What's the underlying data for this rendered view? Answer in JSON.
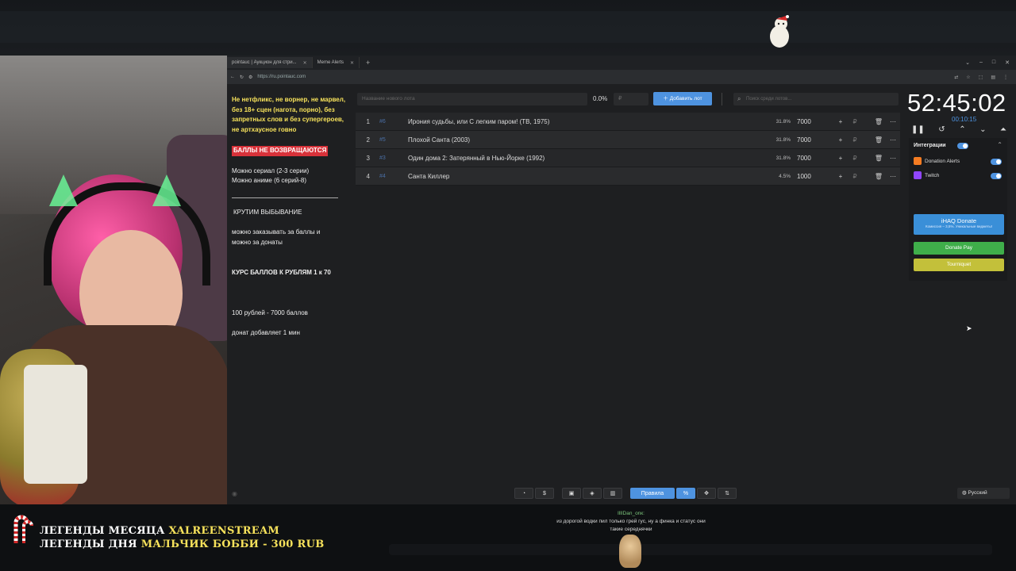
{
  "browser": {
    "tabs": [
      {
        "label": "pointauc | Аукцион для стри...",
        "active": true
      },
      {
        "label": "Meme Alerts",
        "active": false
      }
    ],
    "url": "https://ru.pointauc.com"
  },
  "rules": {
    "headline": "Не нетфликс, не ворнер, не марвел, без 18+ сцен (нагота, порно), без запретных слов и без супергероев, не артхаусное говно",
    "no_refund": "БАЛЛЫ НЕ ВОЗВРАЩАЮТСЯ",
    "series": "Можно сериал (2-3 серии)",
    "anime": "Можно аниме (6 серий-8)",
    "elimination": "КРУТИМ ВЫБЫВАНИЕ",
    "order_points": "можно заказывать за баллы и",
    "order_donations": "можно  за донаты",
    "rate": "КУРС БАЛЛОВ К РУБЛЯМ 1 к 70",
    "conversion": "100 рублей - 7000 баллов",
    "donation_time": "донат добавляет 1 мин"
  },
  "toolbar": {
    "new_lot_placeholder": "Название нового лота",
    "percent": "0.0%",
    "amount_placeholder": "₽",
    "add_button": "Добавить лот",
    "search_placeholder": "Поиск среди лотов..."
  },
  "lots": [
    {
      "n": "1",
      "id": "#6",
      "name": "Ирония судьбы, или С легким паром! (ТВ, 1975)",
      "percent": "31.8%",
      "amount": "7000"
    },
    {
      "n": "2",
      "id": "#5",
      "name": "Плохой Санта (2003)",
      "percent": "31.8%",
      "amount": "7000"
    },
    {
      "n": "3",
      "id": "#3",
      "name": "Один дома 2: Затерянный в Нью-Йорке (1992)",
      "percent": "31.8%",
      "amount": "7000"
    },
    {
      "n": "4",
      "id": "#4",
      "name": "Санта Киллер",
      "percent": "4.5%",
      "amount": "1000"
    }
  ],
  "timer": {
    "main": "52:45:02",
    "sub": "00:10:15"
  },
  "integrations": {
    "title": "Интеграции",
    "donation_alerts": "Donation Alerts",
    "twitch": "Twitch",
    "ihaq_title": "iHAQ Donate",
    "ihaq_sub": "Комиссия – 3,5%. Уникальные виджеты!",
    "donate_pay": "Donate Pay",
    "tourniquet": "Tourniquet",
    "colors": {
      "accent": "#4e93e0",
      "donate_pay": "#3fae4a",
      "tourniquet": "#c3c03a"
    }
  },
  "bottom": {
    "rules_button": "Правила",
    "language": "Русский"
  },
  "overlay": {
    "legend_month_label": "ЛЕГЕНДЫ МЕСЯЦА",
    "legend_month_value": "XALREENSTREAM",
    "legend_day_label": "ЛЕГЕНДЫ ДНЯ",
    "legend_day_value": "МАЛЬЧИК БОББИ - 300 RUB",
    "chat_user": "IllIDan_onк:",
    "chat_message": "из дорогой водки пил только грей гус, ну а финка и статус они такие середнячки"
  }
}
